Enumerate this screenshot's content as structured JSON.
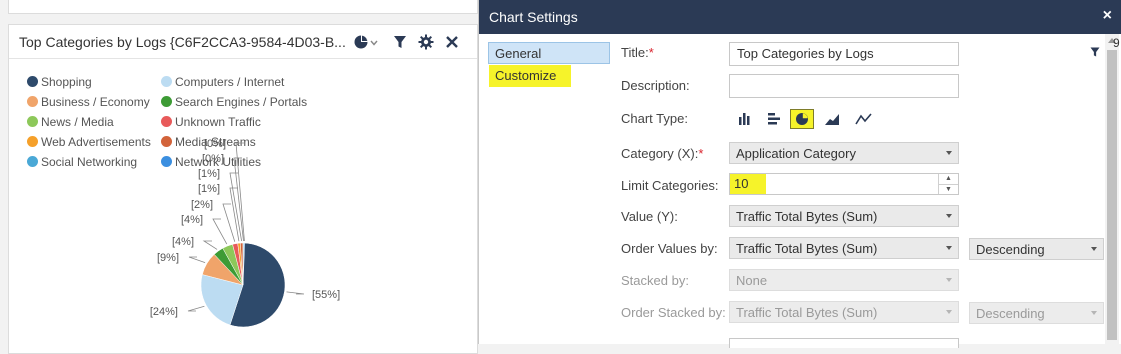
{
  "widget": {
    "title": "Top Categories by Logs {C6F2CCA3-9584-4D03-B...",
    "legend": [
      {
        "label": "Shopping",
        "color": "#2e4a6b"
      },
      {
        "label": "Business / Economy",
        "color": "#f0a46a"
      },
      {
        "label": "News / Media",
        "color": "#8dc85a"
      },
      {
        "label": "Web Advertisements",
        "color": "#f5a02a"
      },
      {
        "label": "Social Networking",
        "color": "#4aa8d6"
      },
      {
        "label": "Computers / Internet",
        "color": "#bcdcf2"
      },
      {
        "label": "Search Engines / Portals",
        "color": "#3d9b35"
      },
      {
        "label": "Unknown Traffic",
        "color": "#e85a5a"
      },
      {
        "label": "Media Streams",
        "color": "#d2633a"
      },
      {
        "label": "Network Utilities",
        "color": "#3b8fe0"
      }
    ],
    "pie_labels": [
      "[55%]",
      "[24%]",
      "[9%]",
      "[4%]",
      "[4%]",
      "[2%]",
      "[1%]",
      "[1%]",
      "[0%]",
      "[0%]"
    ],
    "icons": [
      "pie-chart-icon",
      "chevron-down-icon",
      "filter-icon",
      "gear-icon",
      "close-icon"
    ]
  },
  "chart_data": {
    "type": "pie",
    "categories": [
      "Shopping",
      "Computers / Internet",
      "Business / Economy",
      "Search Engines / Portals",
      "News / Media",
      "Unknown Traffic",
      "Web Advertisements",
      "Media Streams",
      "Social Networking",
      "Network Utilities"
    ],
    "values": [
      55,
      24,
      9,
      4,
      4,
      2,
      1,
      1,
      0,
      0
    ],
    "colors": [
      "#2e4a6b",
      "#bcdcf2",
      "#f0a46a",
      "#3d9b35",
      "#8dc85a",
      "#e85a5a",
      "#f5a02a",
      "#d2633a",
      "#4aa8d6",
      "#3b8fe0"
    ],
    "legend_position": "top-left"
  },
  "dialog": {
    "title": "Chart Settings",
    "close": "×",
    "nav": {
      "general": "General",
      "customize": "Customize"
    },
    "form": {
      "title_label": "Title:",
      "title_value": "Top Categories by Logs",
      "description_label": "Description:",
      "description_value": "",
      "chart_type_label": "Chart Type:",
      "category_label": "Category (X):",
      "category_value": "Application Category",
      "limit_label": "Limit Categories:",
      "limit_value": "10",
      "value_label": "Value (Y):",
      "value_value": "Traffic Total Bytes (Sum)",
      "order_label": "Order Values by:",
      "order_value": "Traffic Total Bytes (Sum)",
      "order_direction": "Descending",
      "stacked_label": "Stacked by:",
      "stacked_value": "None",
      "order_stacked_label": "Order Stacked by:",
      "order_stacked_value": "Traffic Total Bytes (Sum)",
      "order_stacked_direction": "Descending",
      "required_mark": "*"
    },
    "edge_char": "9"
  }
}
